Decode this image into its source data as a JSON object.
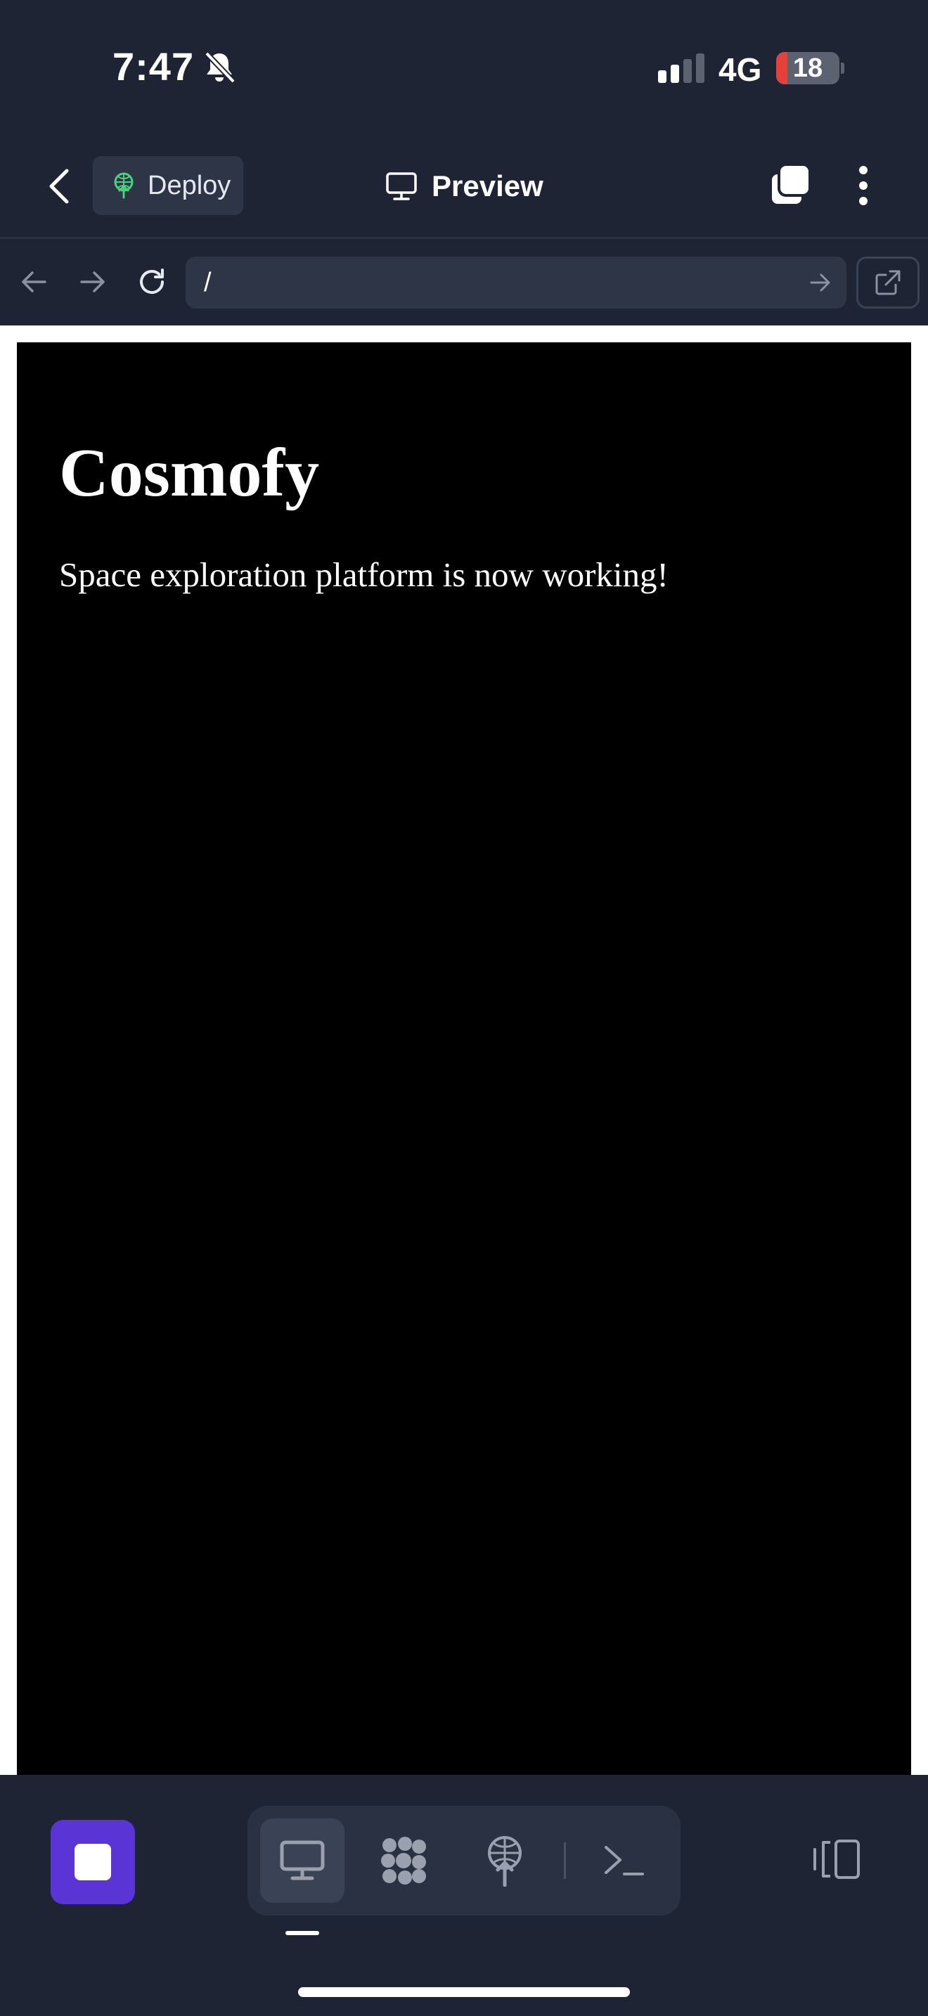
{
  "status_bar": {
    "time": "7:47",
    "network": "4G",
    "battery_level": "18",
    "battery_fraction": 0.18,
    "battery_color": "#e5413a"
  },
  "header": {
    "deploy_label": "Deploy",
    "title": "Preview",
    "icons": [
      "chevron-left-icon",
      "deploy-icon",
      "monitor-icon",
      "tabs-icon",
      "more-vertical-icon"
    ]
  },
  "browser": {
    "url": "/",
    "icons": [
      "arrow-left-icon",
      "arrow-right-icon",
      "refresh-icon",
      "arrow-right-icon",
      "external-link-icon"
    ]
  },
  "page": {
    "title": "Cosmofy",
    "message": "Space exploration platform is now working!"
  },
  "bottom_nav": {
    "accent_color": "#5b34d6",
    "active_tab": "preview",
    "icons": [
      "stop-icon",
      "monitor-icon",
      "agents-icon",
      "deploy-icon",
      "terminal-icon",
      "split-view-icon"
    ]
  }
}
